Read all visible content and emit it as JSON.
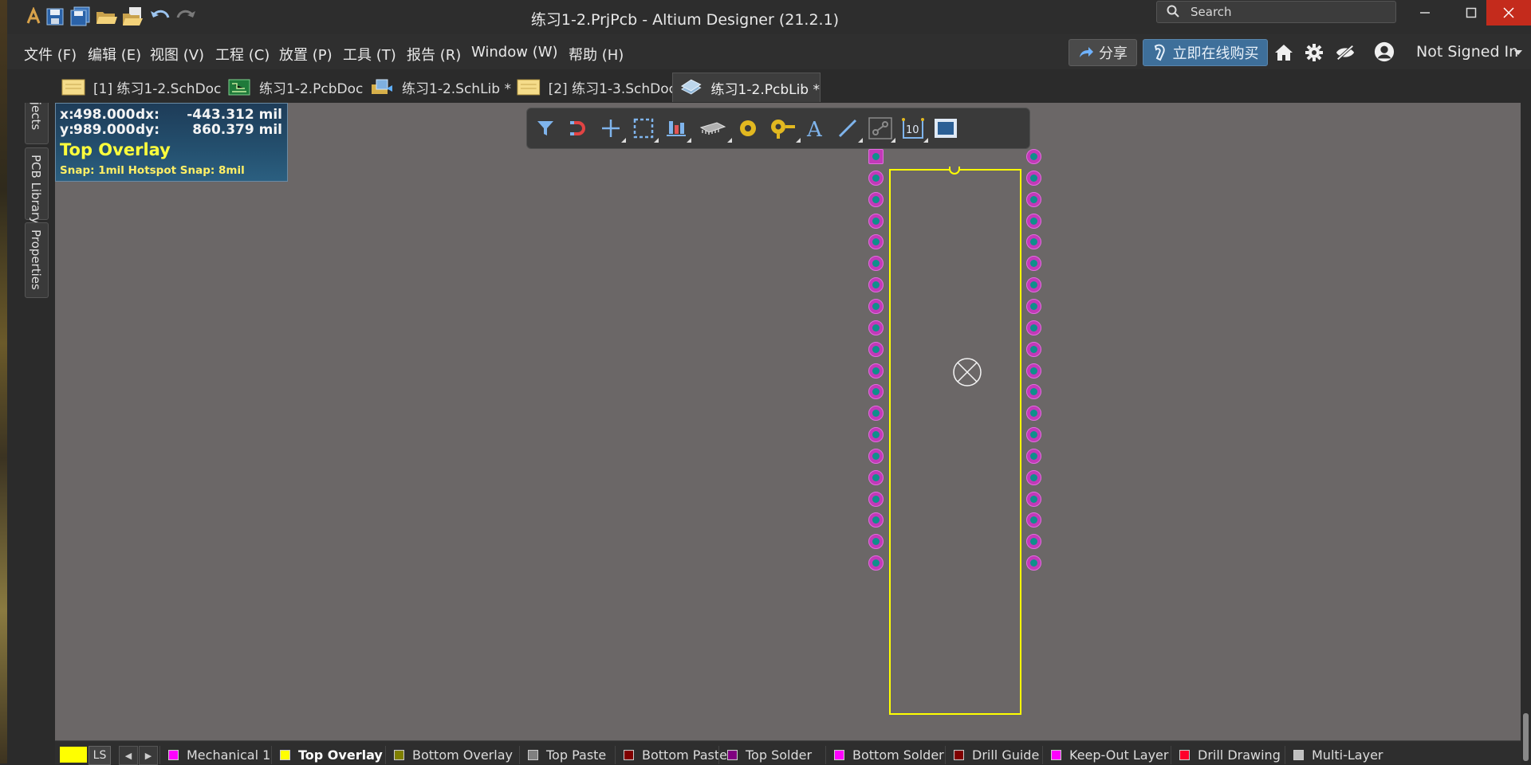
{
  "window": {
    "title": "练习1-2.PrjPcb - Altium Designer (21.2.1)",
    "search_placeholder": "Search"
  },
  "menu": {
    "items": [
      "文件 (F)",
      "编辑 (E)",
      "视图 (V)",
      "工程 (C)",
      "放置 (P)",
      "工具 (T)",
      "报告 (R)",
      "Window (W)",
      "帮助 (H)"
    ],
    "share_label": "分享",
    "buy_label": "立即在线购买",
    "user_label": "Not Signed In"
  },
  "tabs": [
    {
      "label": "[1] 练习1-2.SchDoc",
      "icon": "schematic-doc-icon"
    },
    {
      "label": "练习1-2.PcbDoc",
      "icon": "pcb-doc-icon"
    },
    {
      "label": "练习1-2.SchLib *",
      "icon": "schlib-icon"
    },
    {
      "label": "[2] 练习1-3.SchDoc",
      "icon": "schematic-doc-icon"
    },
    {
      "label": "练习1-2.PcbLib *",
      "icon": "pcblib-icon",
      "active": true
    }
  ],
  "side_panels": [
    "Projects",
    "PCB Library",
    "Properties"
  ],
  "hud": {
    "x_label": "x:",
    "x_value": "498.000",
    "dx_label": "dx:",
    "dx_value": "-443.312 mil",
    "y_label": "y:",
    "y_value": "989.000",
    "dy_label": "dy:",
    "dy_value": "860.379 mil",
    "layer": "Top Overlay",
    "snap": "Snap: 1mil Hotspot Snap: 8mil"
  },
  "toolbar_icons": [
    "filter-icon",
    "snap-magnet-icon",
    "cross-move-icon",
    "select-rect-icon",
    "align-icon",
    "component-icon",
    "pad-icon",
    "via-icon",
    "text-icon",
    "line-icon",
    "route-icon",
    "dimension-icon",
    "region-icon"
  ],
  "footprint": {
    "pads_per_side": 20,
    "pin1_shape": "square",
    "pad_color": "#c23ab8",
    "hole_color": "#0f8f8c",
    "overlay_color": "#ffff00"
  },
  "layers": {
    "current_color": "#ffff00",
    "ls_label": "LS",
    "items": [
      {
        "name": "Mechanical 1",
        "color": "#ff00ff"
      },
      {
        "name": "Top Overlay",
        "color": "#ffff00",
        "active": true
      },
      {
        "name": "Bottom Overlay",
        "color": "#808000"
      },
      {
        "name": "Top Paste",
        "color": "#808080"
      },
      {
        "name": "Bottom Paste",
        "color": "#800000"
      },
      {
        "name": "Top Solder",
        "color": "#800080"
      },
      {
        "name": "Bottom Solder",
        "color": "#ff00ff"
      },
      {
        "name": "Drill Guide",
        "color": "#800000"
      },
      {
        "name": "Keep-Out Layer",
        "color": "#ff00ff"
      },
      {
        "name": "Drill Drawing",
        "color": "#ff002a"
      },
      {
        "name": "Multi-Layer",
        "color": "#c0c0c0"
      }
    ]
  }
}
